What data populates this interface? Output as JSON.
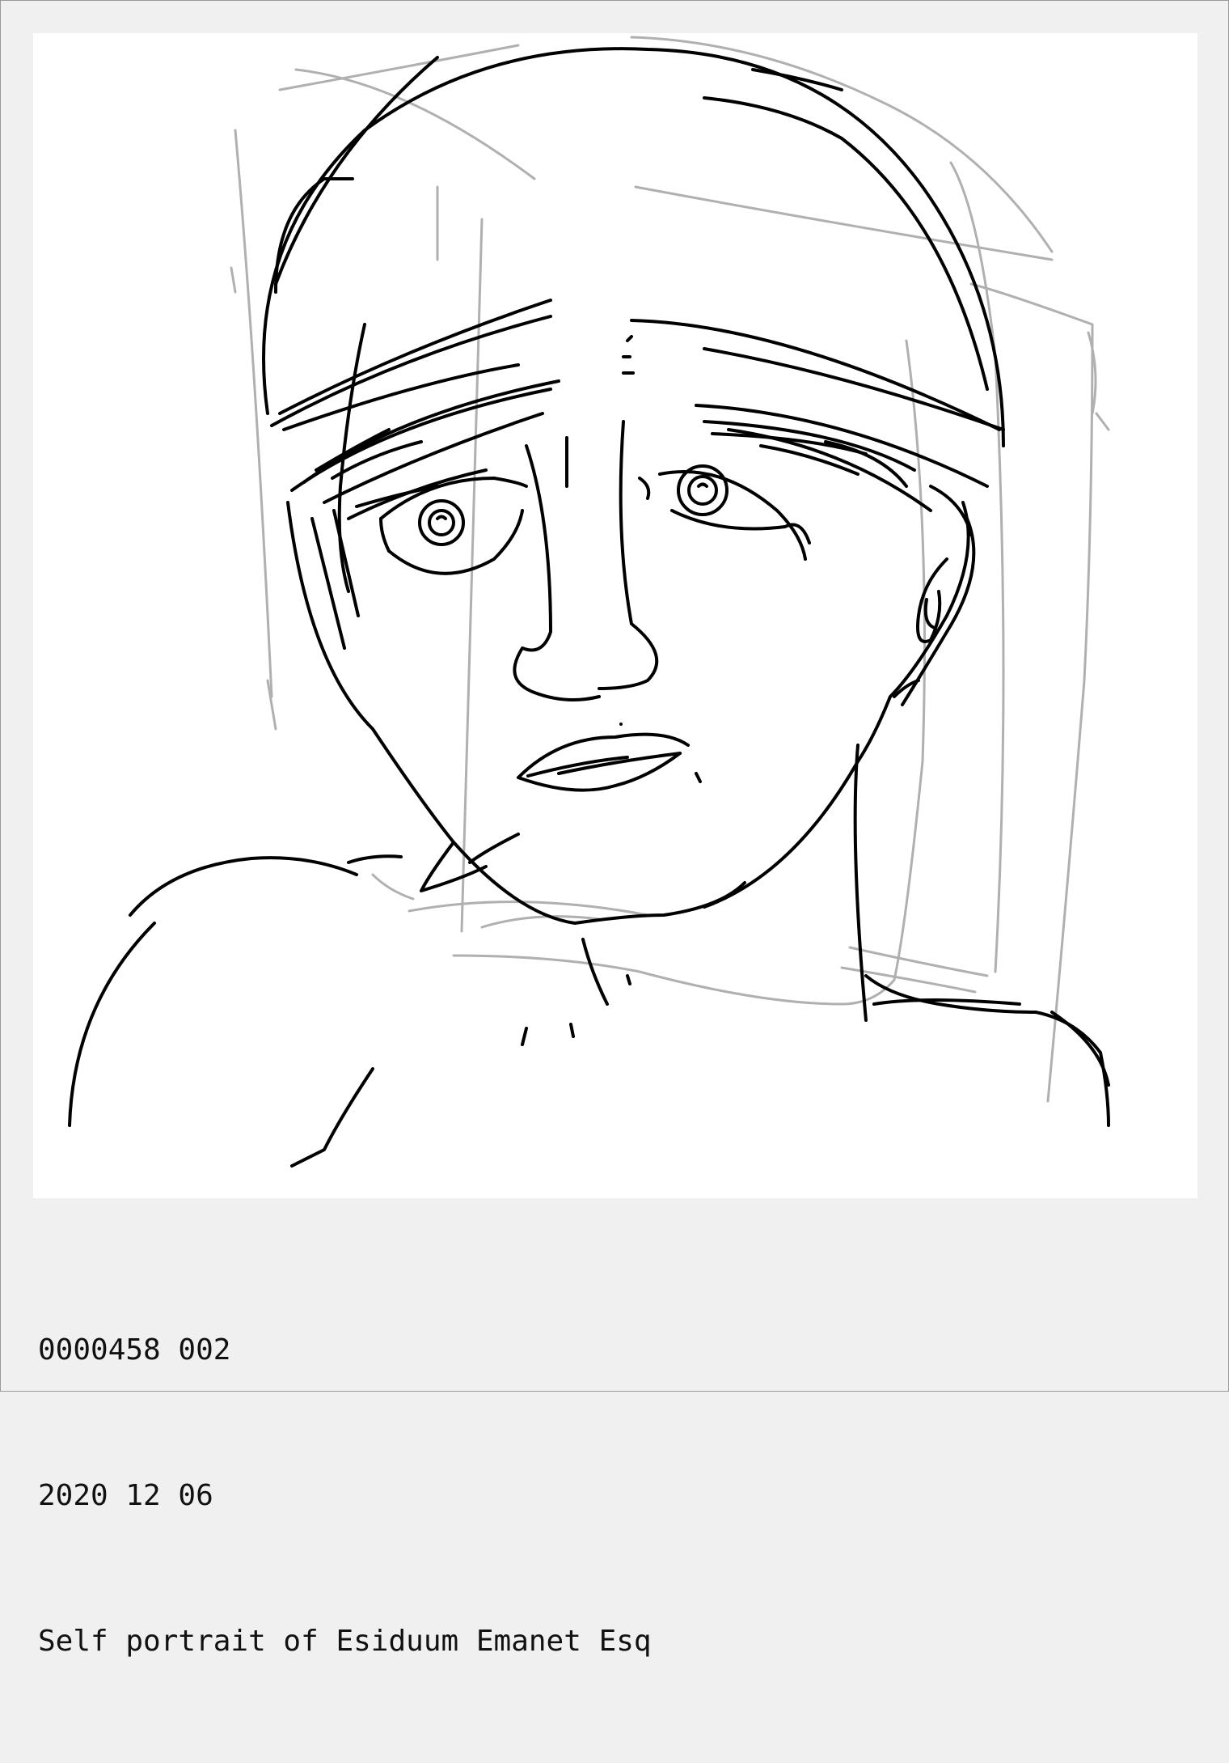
{
  "artwork": {
    "kind": "line drawing",
    "subject": "face portrait sketch",
    "ink_color": "#000000",
    "guide_color": "#b0b0b0",
    "background": "#ffffff"
  },
  "caption": {
    "id_line": "0000458 002",
    "date_line": "2020 12 06",
    "title_line": "Self portrait of Esiduum Emanet Esq"
  }
}
